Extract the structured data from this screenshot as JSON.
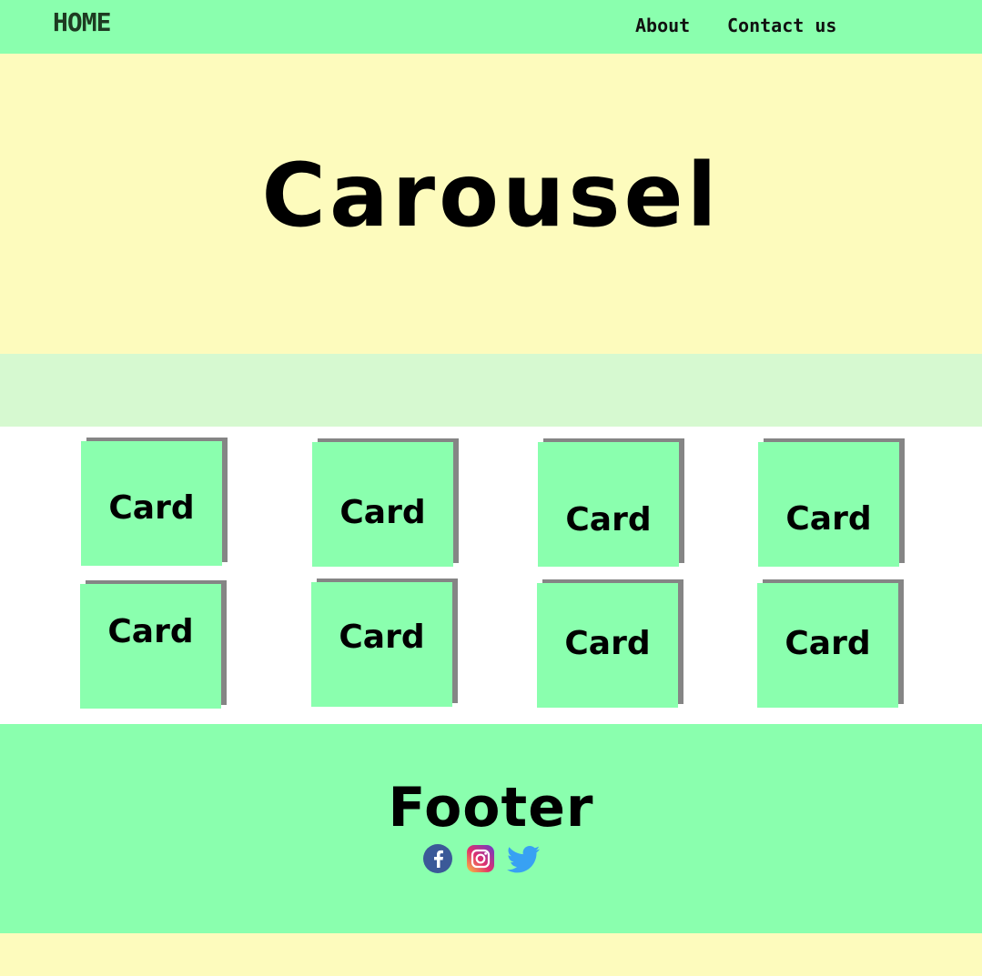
{
  "nav": {
    "home": "HOME",
    "links": [
      "About",
      "Contact us"
    ]
  },
  "hero": {
    "title": "Carousel"
  },
  "cards": {
    "label": "Card",
    "items": [
      "Card",
      "Card",
      "Card",
      "Card",
      "Card",
      "Card",
      "Card",
      "Card"
    ]
  },
  "footer": {
    "title": "Footer",
    "social_icons": [
      "facebook-icon",
      "instagram-icon",
      "twitter-icon"
    ]
  },
  "colors": {
    "nav_bg": "#8affae",
    "hero_bg": "#fdfbbd",
    "band_bg": "#d6f9d0",
    "card_bg": "#8affae",
    "card_shadow": "#858585",
    "footer_bg": "#8affae"
  }
}
